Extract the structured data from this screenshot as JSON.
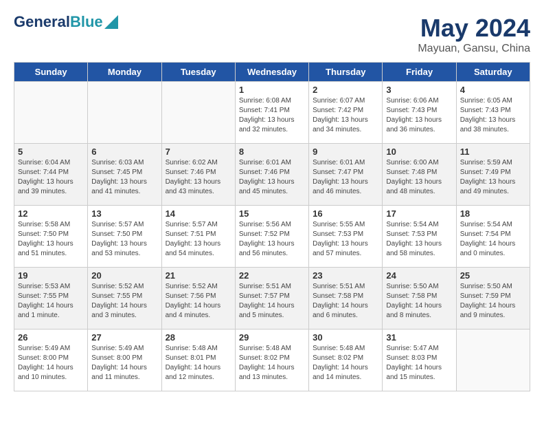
{
  "header": {
    "logo_line1": "General",
    "logo_line2": "Blue",
    "month": "May 2024",
    "location": "Mayuan, Gansu, China"
  },
  "weekdays": [
    "Sunday",
    "Monday",
    "Tuesday",
    "Wednesday",
    "Thursday",
    "Friday",
    "Saturday"
  ],
  "weeks": [
    [
      {
        "day": "",
        "info": ""
      },
      {
        "day": "",
        "info": ""
      },
      {
        "day": "",
        "info": ""
      },
      {
        "day": "1",
        "info": "Sunrise: 6:08 AM\nSunset: 7:41 PM\nDaylight: 13 hours\nand 32 minutes."
      },
      {
        "day": "2",
        "info": "Sunrise: 6:07 AM\nSunset: 7:42 PM\nDaylight: 13 hours\nand 34 minutes."
      },
      {
        "day": "3",
        "info": "Sunrise: 6:06 AM\nSunset: 7:43 PM\nDaylight: 13 hours\nand 36 minutes."
      },
      {
        "day": "4",
        "info": "Sunrise: 6:05 AM\nSunset: 7:43 PM\nDaylight: 13 hours\nand 38 minutes."
      }
    ],
    [
      {
        "day": "5",
        "info": "Sunrise: 6:04 AM\nSunset: 7:44 PM\nDaylight: 13 hours\nand 39 minutes."
      },
      {
        "day": "6",
        "info": "Sunrise: 6:03 AM\nSunset: 7:45 PM\nDaylight: 13 hours\nand 41 minutes."
      },
      {
        "day": "7",
        "info": "Sunrise: 6:02 AM\nSunset: 7:46 PM\nDaylight: 13 hours\nand 43 minutes."
      },
      {
        "day": "8",
        "info": "Sunrise: 6:01 AM\nSunset: 7:46 PM\nDaylight: 13 hours\nand 45 minutes."
      },
      {
        "day": "9",
        "info": "Sunrise: 6:01 AM\nSunset: 7:47 PM\nDaylight: 13 hours\nand 46 minutes."
      },
      {
        "day": "10",
        "info": "Sunrise: 6:00 AM\nSunset: 7:48 PM\nDaylight: 13 hours\nand 48 minutes."
      },
      {
        "day": "11",
        "info": "Sunrise: 5:59 AM\nSunset: 7:49 PM\nDaylight: 13 hours\nand 49 minutes."
      }
    ],
    [
      {
        "day": "12",
        "info": "Sunrise: 5:58 AM\nSunset: 7:50 PM\nDaylight: 13 hours\nand 51 minutes."
      },
      {
        "day": "13",
        "info": "Sunrise: 5:57 AM\nSunset: 7:50 PM\nDaylight: 13 hours\nand 53 minutes."
      },
      {
        "day": "14",
        "info": "Sunrise: 5:57 AM\nSunset: 7:51 PM\nDaylight: 13 hours\nand 54 minutes."
      },
      {
        "day": "15",
        "info": "Sunrise: 5:56 AM\nSunset: 7:52 PM\nDaylight: 13 hours\nand 56 minutes."
      },
      {
        "day": "16",
        "info": "Sunrise: 5:55 AM\nSunset: 7:53 PM\nDaylight: 13 hours\nand 57 minutes."
      },
      {
        "day": "17",
        "info": "Sunrise: 5:54 AM\nSunset: 7:53 PM\nDaylight: 13 hours\nand 58 minutes."
      },
      {
        "day": "18",
        "info": "Sunrise: 5:54 AM\nSunset: 7:54 PM\nDaylight: 14 hours\nand 0 minutes."
      }
    ],
    [
      {
        "day": "19",
        "info": "Sunrise: 5:53 AM\nSunset: 7:55 PM\nDaylight: 14 hours\nand 1 minute."
      },
      {
        "day": "20",
        "info": "Sunrise: 5:52 AM\nSunset: 7:55 PM\nDaylight: 14 hours\nand 3 minutes."
      },
      {
        "day": "21",
        "info": "Sunrise: 5:52 AM\nSunset: 7:56 PM\nDaylight: 14 hours\nand 4 minutes."
      },
      {
        "day": "22",
        "info": "Sunrise: 5:51 AM\nSunset: 7:57 PM\nDaylight: 14 hours\nand 5 minutes."
      },
      {
        "day": "23",
        "info": "Sunrise: 5:51 AM\nSunset: 7:58 PM\nDaylight: 14 hours\nand 6 minutes."
      },
      {
        "day": "24",
        "info": "Sunrise: 5:50 AM\nSunset: 7:58 PM\nDaylight: 14 hours\nand 8 minutes."
      },
      {
        "day": "25",
        "info": "Sunrise: 5:50 AM\nSunset: 7:59 PM\nDaylight: 14 hours\nand 9 minutes."
      }
    ],
    [
      {
        "day": "26",
        "info": "Sunrise: 5:49 AM\nSunset: 8:00 PM\nDaylight: 14 hours\nand 10 minutes."
      },
      {
        "day": "27",
        "info": "Sunrise: 5:49 AM\nSunset: 8:00 PM\nDaylight: 14 hours\nand 11 minutes."
      },
      {
        "day": "28",
        "info": "Sunrise: 5:48 AM\nSunset: 8:01 PM\nDaylight: 14 hours\nand 12 minutes."
      },
      {
        "day": "29",
        "info": "Sunrise: 5:48 AM\nSunset: 8:02 PM\nDaylight: 14 hours\nand 13 minutes."
      },
      {
        "day": "30",
        "info": "Sunrise: 5:48 AM\nSunset: 8:02 PM\nDaylight: 14 hours\nand 14 minutes."
      },
      {
        "day": "31",
        "info": "Sunrise: 5:47 AM\nSunset: 8:03 PM\nDaylight: 14 hours\nand 15 minutes."
      },
      {
        "day": "",
        "info": ""
      }
    ]
  ]
}
